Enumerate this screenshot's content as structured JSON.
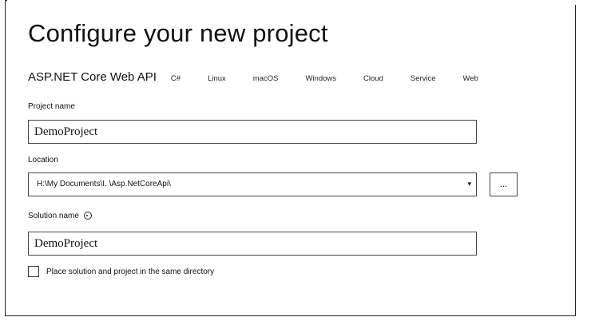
{
  "page": {
    "title": "Configure your new project"
  },
  "template": {
    "name": "ASP.NET Core Web API",
    "tags": [
      "C#",
      "Linux",
      "macOS",
      "Windows",
      "Cloud",
      "Service",
      "Web"
    ]
  },
  "project_name": {
    "label": "Project name",
    "value": "DemoProject"
  },
  "location": {
    "label": "Location",
    "value": "H:\\My Documents\\I.        \\Asp.NetCoreApi\\",
    "browse_label": "..."
  },
  "solution_name": {
    "label": "Solution name",
    "value": "DemoProject",
    "info_icon": "info-icon"
  },
  "same_directory": {
    "label": "Place solution and project in the same directory",
    "checked": false
  }
}
